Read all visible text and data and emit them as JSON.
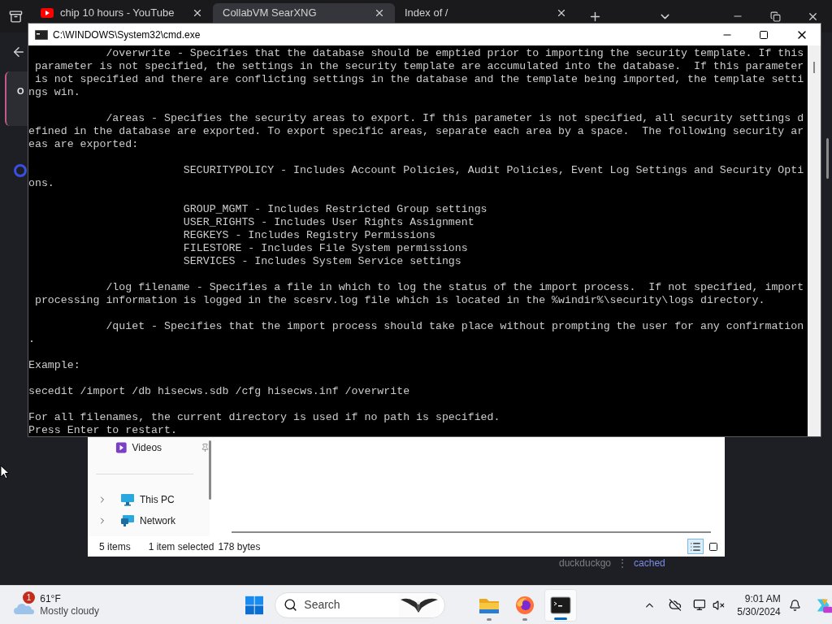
{
  "browser": {
    "tabs": [
      {
        "title": "chip 10 hours - YouTube",
        "selected": false
      },
      {
        "title": "CollabVM SearXNG",
        "selected": true
      },
      {
        "title": "Index of /",
        "selected": false
      }
    ],
    "card_text": "O",
    "result_engine": "duckduckgo",
    "result_separator": "⋮",
    "result_link": "cached"
  },
  "cmd": {
    "title": "C:\\WINDOWS\\System32\\cmd.exe",
    "paragraphs": [
      [
        "            /overwrite - Specifies that the database should be emptied prior to importing the security template. If this",
        " parameter is not specified, the settings in the security template are accumulated into the database.  If this parameter",
        " is not specified and there are conflicting settings in the database and the template being imported, the template setti",
        "ngs win."
      ],
      [
        "            /areas - Specifies the security areas to export. If this parameter is not specified, all security settings d",
        "efined in the database are exported. To export specific areas, separate each area by a space.  The following security ar",
        "eas are exported:"
      ],
      [
        "                        SECURITYPOLICY - Includes Account Policies, Audit Policies, Event Log Settings and Security Opti",
        "ons."
      ],
      [
        "                        GROUP_MGMT - Includes Restricted Group settings",
        "                        USER_RIGHTS - Includes User Rights Assignment",
        "                        REGKEYS - Includes Registry Permissions",
        "                        FILESTORE - Includes File System permissions",
        "                        SERVICES - Includes System Service settings"
      ],
      [
        "            /log filename - Specifies a file in which to log the status of the import process.  If not specified, import",
        " processing information is logged in the scesrv.log file which is located in the %windir%\\security\\logs directory."
      ],
      [
        "            /quiet - Specifies that the import process should take place without prompting the user for any confirmation",
        "."
      ],
      [
        "Example:"
      ],
      [
        "secedit /import /db hisecws.sdb /cfg hisecws.inf /overwrite"
      ],
      [
        "For all filenames, the current directory is used if no path is specified.",
        "Press Enter to restart."
      ]
    ]
  },
  "explorer": {
    "nav": [
      {
        "label": "Videos",
        "kind": "videos"
      },
      {
        "label": "This PC",
        "kind": "computer"
      },
      {
        "label": "Network",
        "kind": "network"
      }
    ],
    "status": {
      "count": "5 items",
      "selection": "1 item selected",
      "size": "178 bytes"
    },
    "views": [
      {
        "kind": "details",
        "selected": true
      },
      {
        "kind": "tiles",
        "selected": false
      }
    ]
  },
  "taskbar": {
    "weather": {
      "badge": "1",
      "temperature": "61°F",
      "condition": "Mostly cloudy"
    },
    "search_placeholder": "Search",
    "apps": [
      {
        "kind": "explorer",
        "active": false
      },
      {
        "kind": "firefox",
        "active": false
      },
      {
        "kind": "terminal",
        "active": true
      }
    ],
    "time": "9:01 AM",
    "date": "5/30/2024"
  }
}
